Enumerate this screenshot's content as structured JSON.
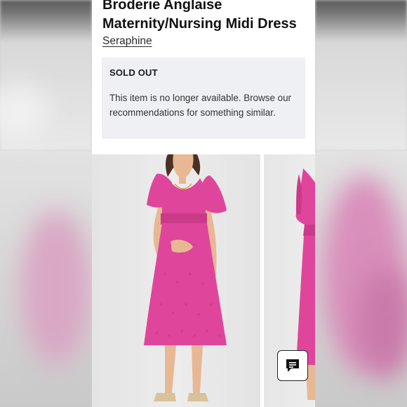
{
  "product": {
    "title_line1": "Broderie Anglaise",
    "title_line2": "Maternity/Nursing Midi Dress",
    "brand": "Seraphine"
  },
  "availability": {
    "status": "SOLD OUT",
    "message": "This item is no longer available. Browse our recommendations for something similar."
  },
  "gallery": {
    "images": [
      {
        "name": "product-photo-front"
      },
      {
        "name": "product-photo-side"
      }
    ]
  },
  "chat": {
    "icon": "chat-bubble-icon"
  },
  "colors": {
    "dress": "#e0459c",
    "notice_bg": "#eef0f3",
    "page_bg": "#ffffff"
  }
}
